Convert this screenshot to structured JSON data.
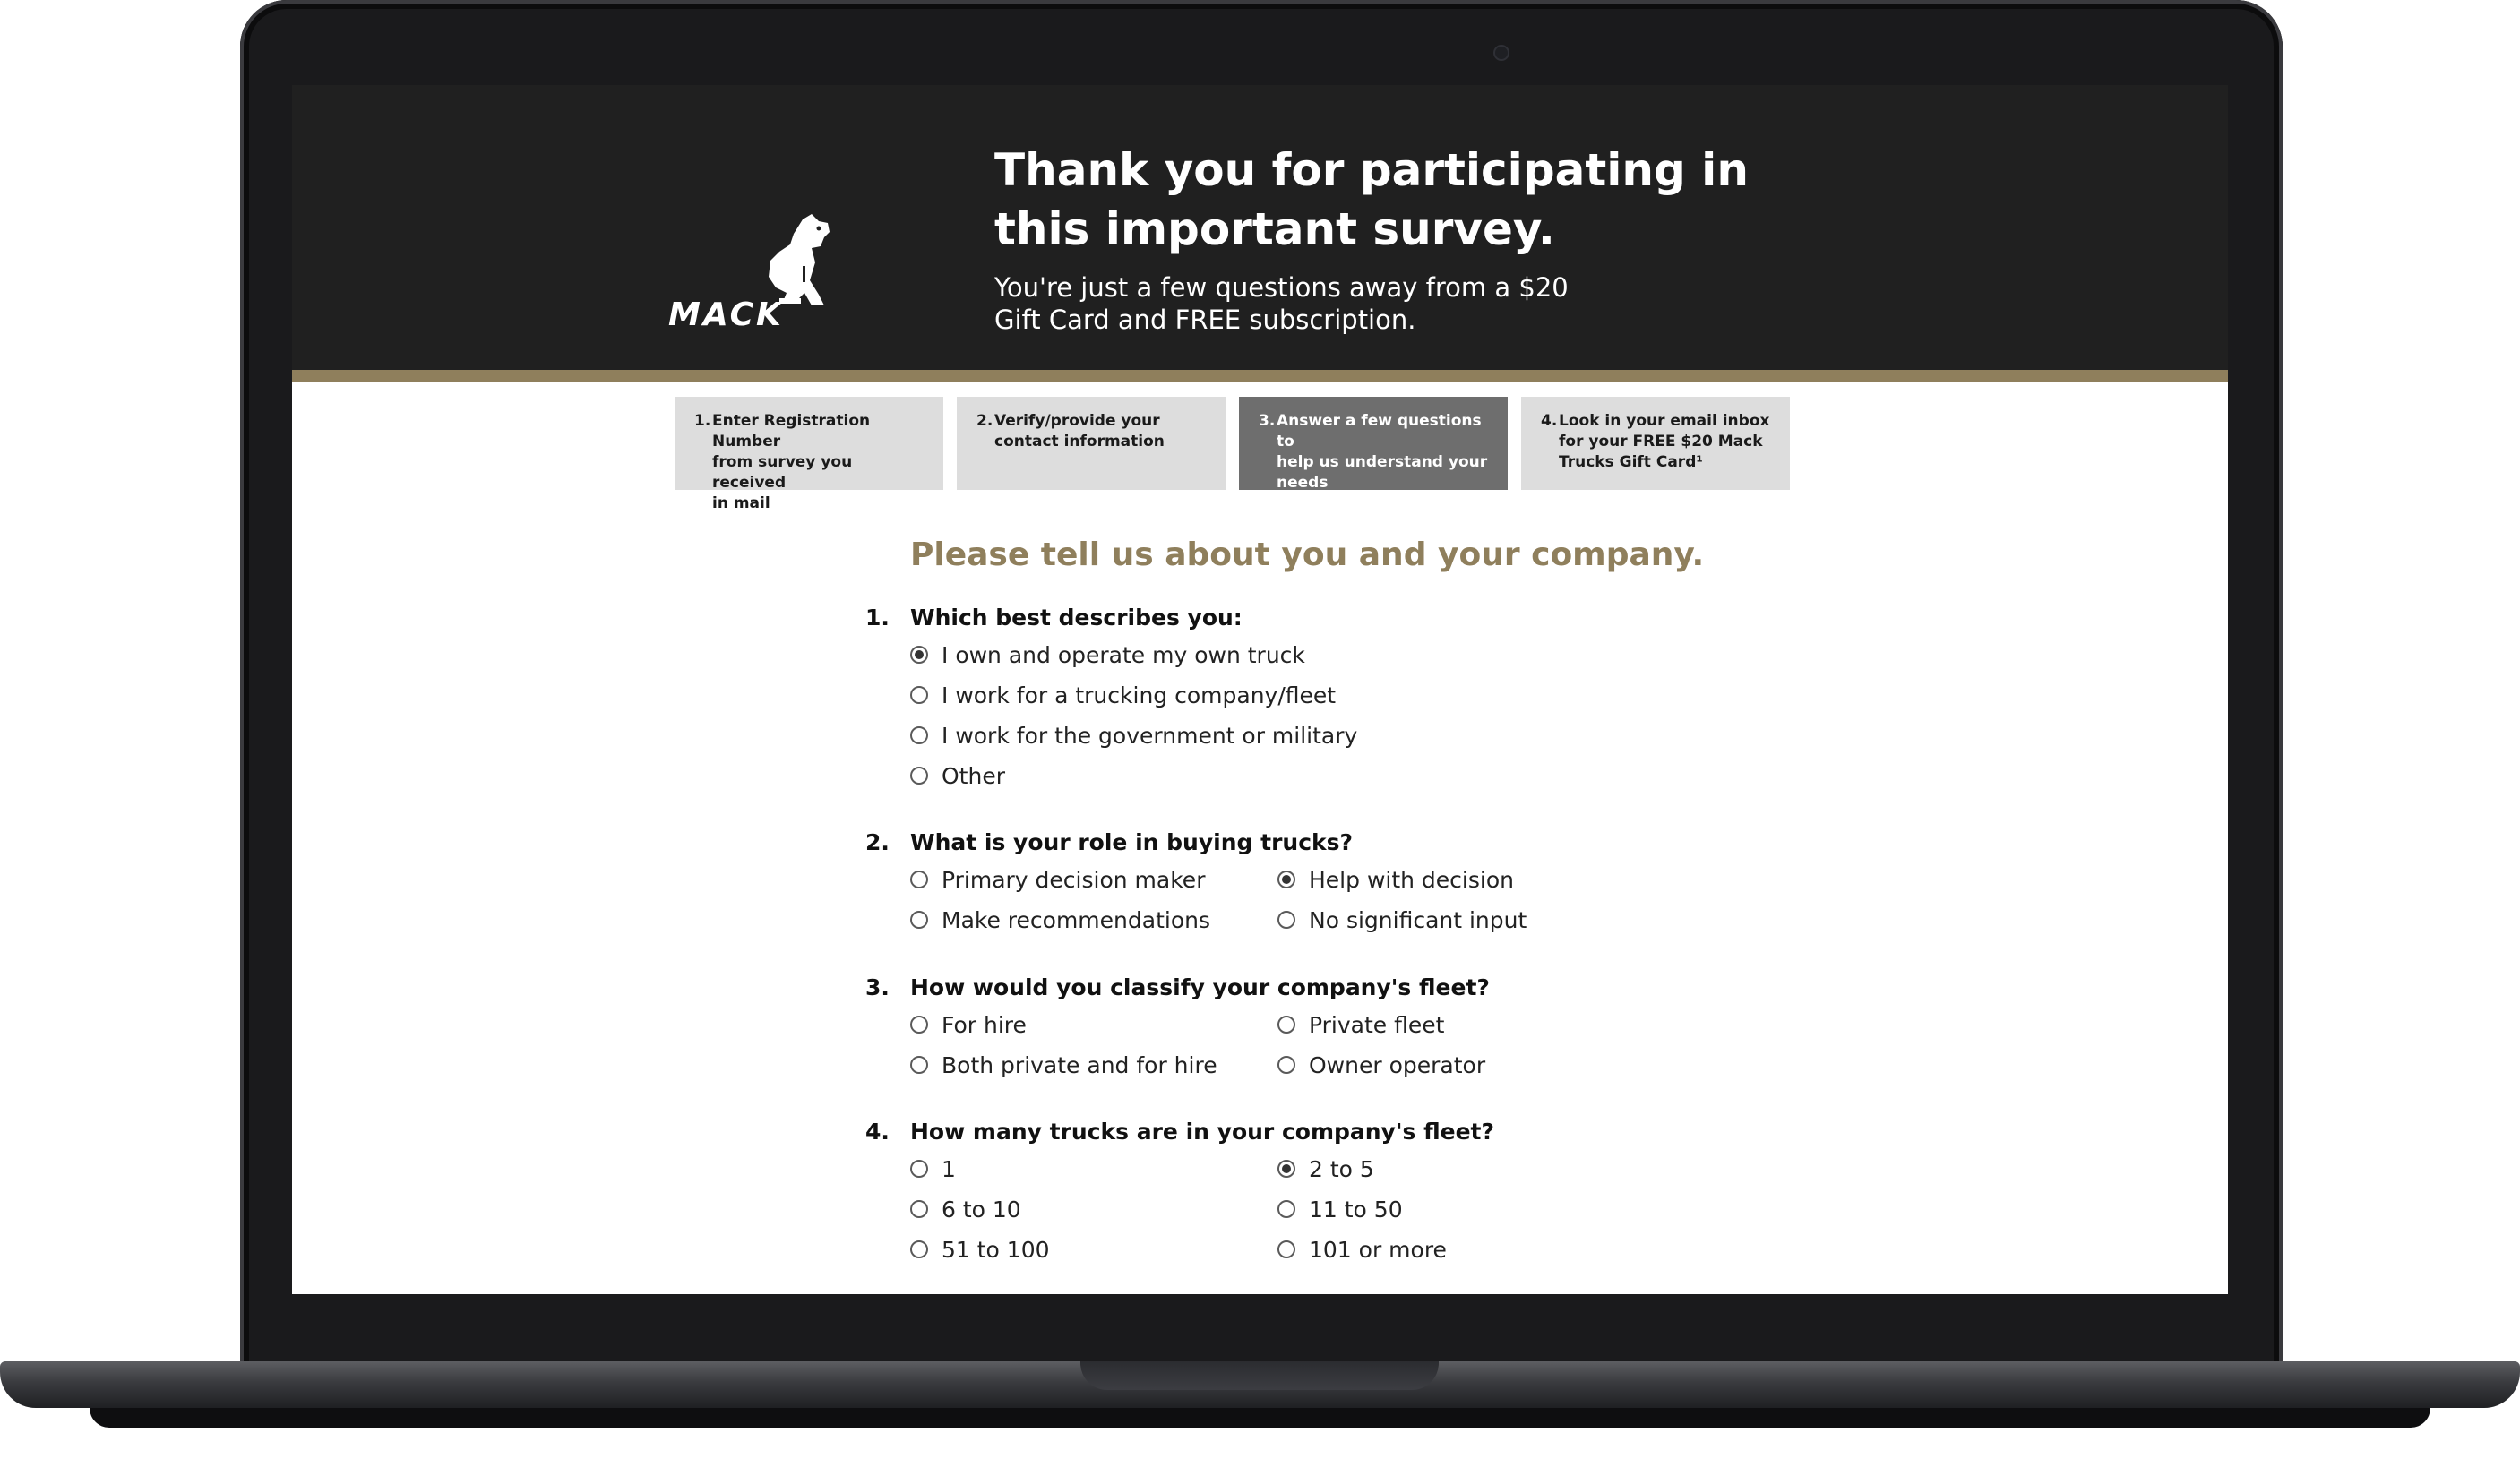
{
  "brand": {
    "logo_text": "MACK",
    "bulldog_icon": "bulldog-icon"
  },
  "hero": {
    "title": "Thank you for participating in this important survey.",
    "subtitle": "You're just a few questions away from a $20 Gift Card and FREE subscription."
  },
  "steps": [
    {
      "num": "1.",
      "label": "Enter Registration Number\nfrom survey you received\nin mail",
      "active": false
    },
    {
      "num": "2.",
      "label": "Verify/provide your\ncontact information",
      "active": false
    },
    {
      "num": "3.",
      "label": "Answer a few questions to\nhelp us understand your\nneeds",
      "active": true
    },
    {
      "num": "4.",
      "label": "Look in your email inbox\nfor your FREE $20 Mack\nTrucks Gift Card¹",
      "active": false
    }
  ],
  "form": {
    "title": "Please tell us about you and your company.",
    "questions": [
      {
        "num": "1.",
        "text": "Which best describes you:",
        "options": [
          {
            "label": "I own and operate my own truck",
            "selected": true
          },
          {
            "label": "I work for a trucking company/fleet",
            "selected": false
          },
          {
            "label": "I work for the government or military",
            "selected": false
          },
          {
            "label": "Other",
            "selected": false
          }
        ]
      },
      {
        "num": "2.",
        "text": "What is your role in buying trucks?",
        "options": [
          {
            "label": "Primary decision maker",
            "selected": false
          },
          {
            "label": "Help with decision",
            "selected": true
          },
          {
            "label": "Make recommendations",
            "selected": false
          },
          {
            "label": "No significant input",
            "selected": false
          }
        ]
      },
      {
        "num": "3.",
        "text": "How would you classify your company's fleet?",
        "options": [
          {
            "label": "For hire",
            "selected": false
          },
          {
            "label": "Private fleet",
            "selected": false
          },
          {
            "label": "Both private and for hire",
            "selected": false
          },
          {
            "label": "Owner operator",
            "selected": false
          }
        ]
      },
      {
        "num": "4.",
        "text": "How many trucks are in your company's fleet?",
        "options": [
          {
            "label": "1",
            "selected": false
          },
          {
            "label": "2 to 5",
            "selected": true
          },
          {
            "label": "6 to 10",
            "selected": false
          },
          {
            "label": "11 to 50",
            "selected": false
          },
          {
            "label": "51 to 100",
            "selected": false
          },
          {
            "label": "101 or more",
            "selected": false
          }
        ]
      }
    ]
  },
  "colors": {
    "accent_gold": "#8f7f5c",
    "hero_bg": "#202020",
    "active_step": "#6e6e6e"
  }
}
